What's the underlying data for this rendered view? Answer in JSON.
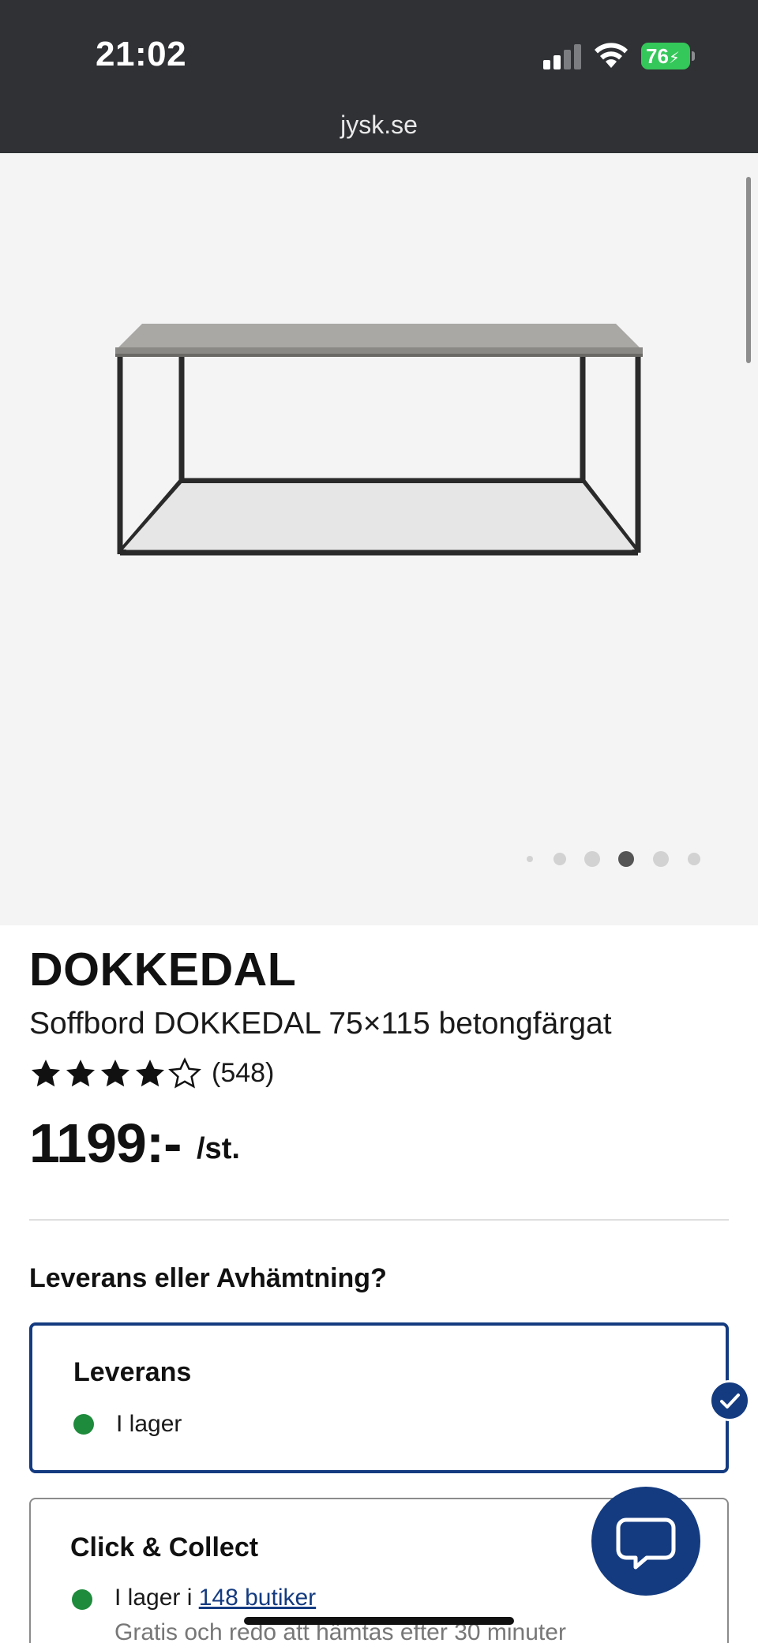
{
  "status_bar": {
    "time": "21:02",
    "battery": "76",
    "url": "jysk.se"
  },
  "gallery": {
    "image_alt": "coffee-table-product-image",
    "active_dot": 3,
    "dot_count": 6
  },
  "product": {
    "brand": "DOKKEDAL",
    "subtitle": "Soffbord DOKKEDAL 75×115 betongfärgat",
    "rating": 4,
    "rating_max": 5,
    "review_count": "(548)",
    "price": "1199:-",
    "unit": "/st."
  },
  "fulfilment": {
    "question": "Leverans eller Avhämtning?",
    "delivery": {
      "title": "Leverans",
      "status": "I lager"
    },
    "collect": {
      "title": "Click & Collect",
      "status_prefix": "I lager i",
      "stores_link": "148 butiker",
      "note": "Gratis och redo att hämtas efter 30 minuter"
    }
  },
  "colors": {
    "accent": "#143b80",
    "in_stock": "#1e8a3c",
    "status_bar": "#2f3134",
    "gallery_bg": "#f4f4f4"
  }
}
